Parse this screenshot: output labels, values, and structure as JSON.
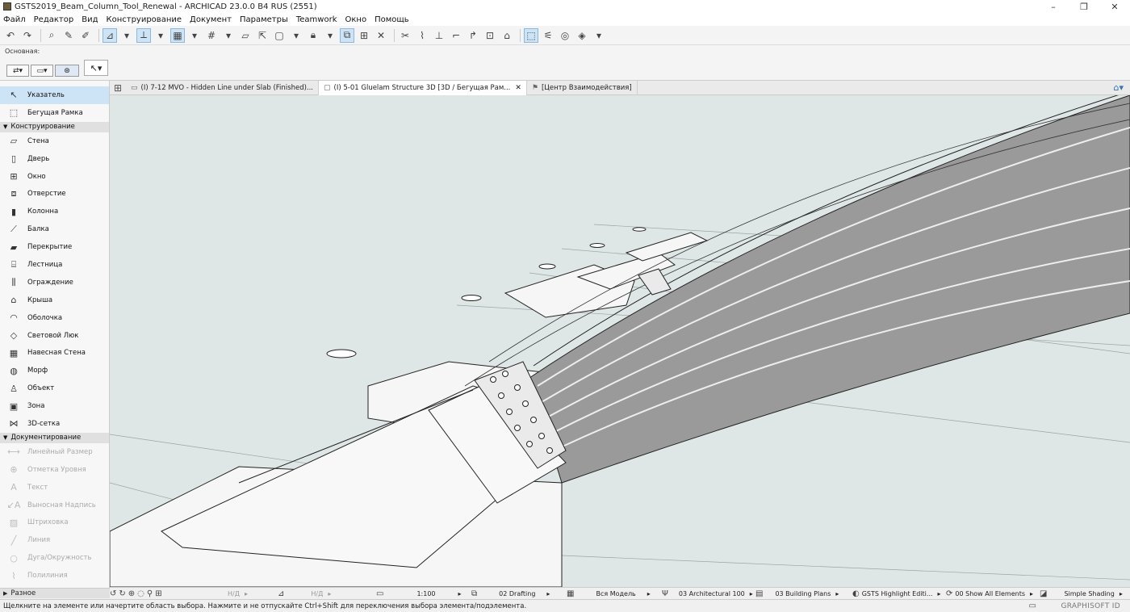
{
  "window": {
    "title": "GSTS2019_Beam_Column_Tool_Renewal - ARCHICAD 23.0.0 B4 RUS (2551)",
    "controls": [
      "–",
      "❐",
      "✕"
    ]
  },
  "menu": [
    "Файл",
    "Редактор",
    "Вид",
    "Конструирование",
    "Документ",
    "Параметры",
    "Teamwork",
    "Окно",
    "Помощь"
  ],
  "infobox": {
    "label": "Основная:"
  },
  "tabs": [
    {
      "label": "(I) 7-12 MVO - Hidden Line under Slab (Finished)...",
      "active": false
    },
    {
      "label": "(I) 5-01 Gluelam Structure 3D [3D / Бегущая Рам...",
      "active": true
    },
    {
      "label": "[Центр Взаимодействия]",
      "active": false
    }
  ],
  "toolbox": {
    "top_tools": [
      {
        "label": "Указатель",
        "icon": "pointer-icon",
        "selected": true
      },
      {
        "label": "Бегущая Рамка",
        "icon": "marquee-icon",
        "selected": false
      }
    ],
    "sections": [
      {
        "title": "Конструирование",
        "tools": [
          {
            "label": "Стена",
            "icon": "wall-icon"
          },
          {
            "label": "Дверь",
            "icon": "door-icon"
          },
          {
            "label": "Окно",
            "icon": "window-icon"
          },
          {
            "label": "Отверстие",
            "icon": "opening-icon"
          },
          {
            "label": "Колонна",
            "icon": "column-icon"
          },
          {
            "label": "Балка",
            "icon": "beam-icon"
          },
          {
            "label": "Перекрытие",
            "icon": "slab-icon"
          },
          {
            "label": "Лестница",
            "icon": "stair-icon"
          },
          {
            "label": "Ограждение",
            "icon": "railing-icon"
          },
          {
            "label": "Крыша",
            "icon": "roof-icon"
          },
          {
            "label": "Оболочка",
            "icon": "shell-icon"
          },
          {
            "label": "Световой Люк",
            "icon": "skylight-icon"
          },
          {
            "label": "Навесная Стена",
            "icon": "curtain-wall-icon"
          },
          {
            "label": "Морф",
            "icon": "morph-icon"
          },
          {
            "label": "Объект",
            "icon": "object-icon"
          },
          {
            "label": "Зона",
            "icon": "zone-icon"
          },
          {
            "label": "3D-сетка",
            "icon": "mesh-icon"
          }
        ]
      },
      {
        "title": "Документирование",
        "tools": [
          {
            "label": "Линейный Размер",
            "icon": "dimension-icon"
          },
          {
            "label": "Отметка Уровня",
            "icon": "level-icon"
          },
          {
            "label": "Текст",
            "icon": "text-icon"
          },
          {
            "label": "Выносная Надпись",
            "icon": "label-icon"
          },
          {
            "label": "Штриховка",
            "icon": "fill-icon"
          },
          {
            "label": "Линия",
            "icon": "line-icon"
          },
          {
            "label": "Дуга/Окружность",
            "icon": "arc-icon"
          },
          {
            "label": "Полилиния",
            "icon": "polyline-icon"
          }
        ]
      }
    ],
    "misc": "Разное"
  },
  "viewctrl": {
    "nd1": "Н/Д",
    "nd2": "Н/Д",
    "scale": "1:100",
    "layer_combo": "02 Drafting",
    "model_view": "Вся Модель",
    "pen_set": "03 Architectural 100",
    "mvo": "03 Building Plans",
    "override": "GSTS Highlight Editi...",
    "renovation": "00 Show All Elements",
    "shading": "Simple Shading"
  },
  "status": {
    "hint": "Щелкните на элементе или начертите область выбора. Нажмите и не отпускайте Ctrl+Shift для переключения выбора элемента/подэлемента.",
    "brand": "GRAPHISOFT ID"
  }
}
